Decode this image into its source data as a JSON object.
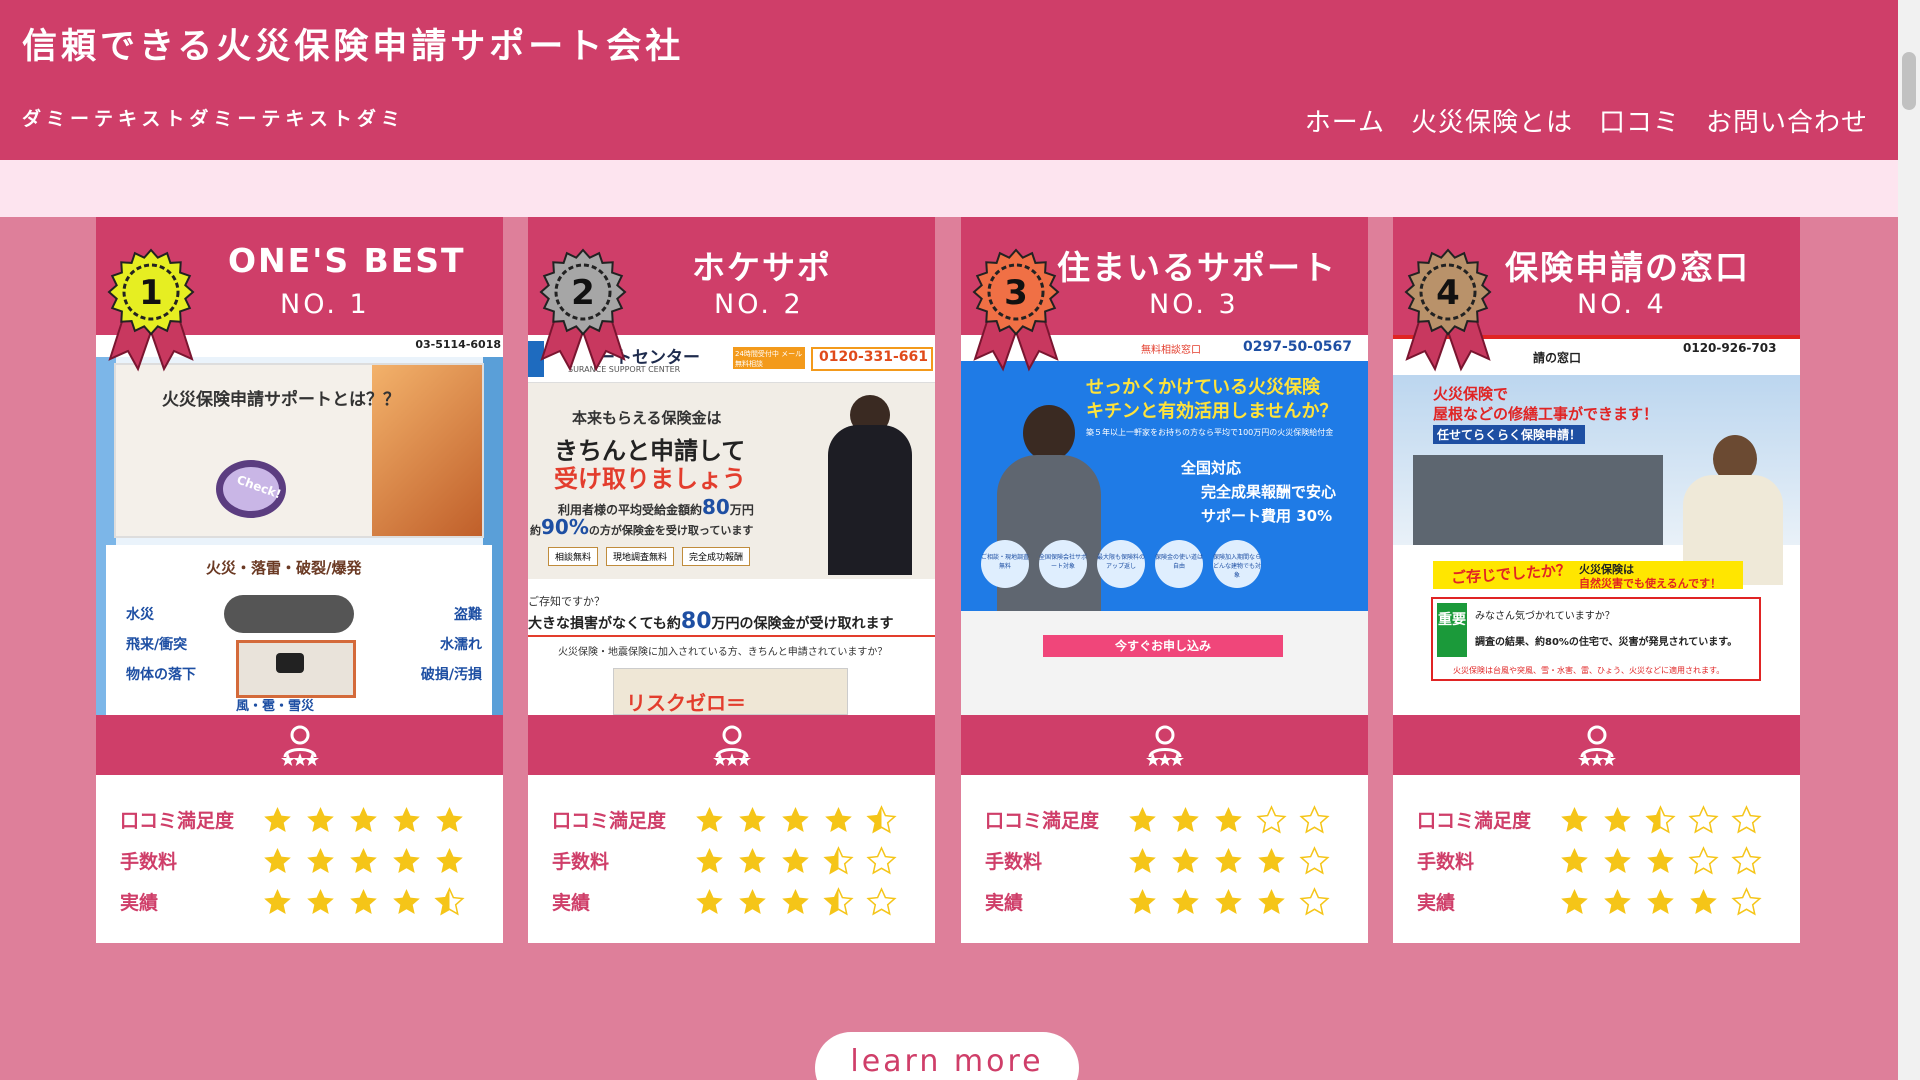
{
  "site": {
    "title": "信頼できる火災保険申請サポート会社",
    "subtitle": "ダミーテキストダミーテキストダミ"
  },
  "nav": [
    "ホーム",
    "火災保険とは",
    "口コミ",
    "お問い合わせ"
  ],
  "rating_labels": [
    "口コミ満足度",
    "手数料",
    "実績"
  ],
  "cards": [
    {
      "name": "ONE'S BEST",
      "rank": "NO. 1",
      "medal_number": "1",
      "medal_color": "#e6ee22",
      "ratings": [
        5,
        5,
        4.5
      ],
      "shot": {
        "phone": "03-5114-6018",
        "popup_title": "火災保険申請サポートとは？？",
        "check": "Check!",
        "video_title": "火災・落雷・破裂/爆発",
        "left_labels": [
          "水災",
          "飛来/衝突",
          "物体の落下"
        ],
        "right_labels": [
          "盗難",
          "水濡れ",
          "破損/汚損"
        ],
        "bottom": "風・雹・雪災"
      }
    },
    {
      "name": "ホケサポ",
      "rank": "NO. 2",
      "medal_number": "2",
      "medal_color": "#a6a6a6",
      "ratings": [
        4.5,
        3.5,
        3.5
      ],
      "shot": {
        "brand": "ートセンター",
        "brand_en": "SURANCE   SUPPORT CENTER",
        "mail": "24時間受付中 メール無料相談",
        "phone": "0120-331-661",
        "line1": "本来もらえる保険金は",
        "line2": "きちんと申請して",
        "line3": "受け取りましょう",
        "avg": "利用者様の平均受給金額約",
        "avg_num": "80",
        "avg_unit": "万円",
        "pct_pre": "約",
        "pct": "90%",
        "pct_post": "の方が保険金を受け取っています",
        "badges": [
          "相談無料",
          "現地調査無料",
          "完全成功報酬"
        ],
        "q": "ご存知ですか？",
        "banner_pre": "大きな損害がなくても約",
        "banner_num": "80",
        "banner_unit": "万円",
        "banner_post": "の保険金が受け取れます",
        "note": "火災保険・地震保険に加入されている方、きちんと申請されていますか？",
        "bottom": "リスクゼロ＝"
      }
    },
    {
      "name": "住まいるサポート",
      "rank": "NO. 3",
      "medal_number": "3",
      "medal_color": "#f07045",
      "ratings": [
        3,
        4,
        4
      ],
      "shot": {
        "free": "無料相談窓口",
        "phone": "0297-50-0567",
        "head1": "せっかくかけている火災保険",
        "head2": "キチンと有効活用しませんか？",
        "sub": "築５年以上一軒家をお持ちの方なら平均で100万円の火災保険給付金",
        "c1": "全国対応",
        "c2": "完全成果報酬で安心",
        "c3": "サポート費用 30%",
        "circles": [
          "ご相談・現地調査無料",
          "全国保険会社サポート対象",
          "最大限も保険料のアップ返し",
          "保険金の使い道は自由",
          "保険加入期間ならどんな建物でも対象"
        ],
        "cta": "今すぐお申し込み"
      }
    },
    {
      "name": "保険申請の窓口",
      "rank": "NO. 4",
      "medal_number": "4",
      "medal_color": "#b9926a",
      "ratings": [
        2.5,
        3,
        4
      ],
      "shot": {
        "brand": "請の窓口",
        "phone": "0120-926-703",
        "head1": "火災保険で",
        "head2": "屋根などの修繕工事ができます！",
        "head3": "任せてらくらく保険申請！",
        "q": "ご存じでしたか？",
        "q2": "火災保険は",
        "q3": "自然災害でも使えるんです！",
        "important": "重要",
        "imp1": "みなさん気づかれていますか？",
        "imp2": "調査の結果、約80%の住宅で、災害が発見されています。",
        "foot": "火災保険は台風や突風、雪・水害、雷、ひょう、火災などに適用されます。"
      }
    }
  ],
  "cta": {
    "label": "learn more"
  }
}
